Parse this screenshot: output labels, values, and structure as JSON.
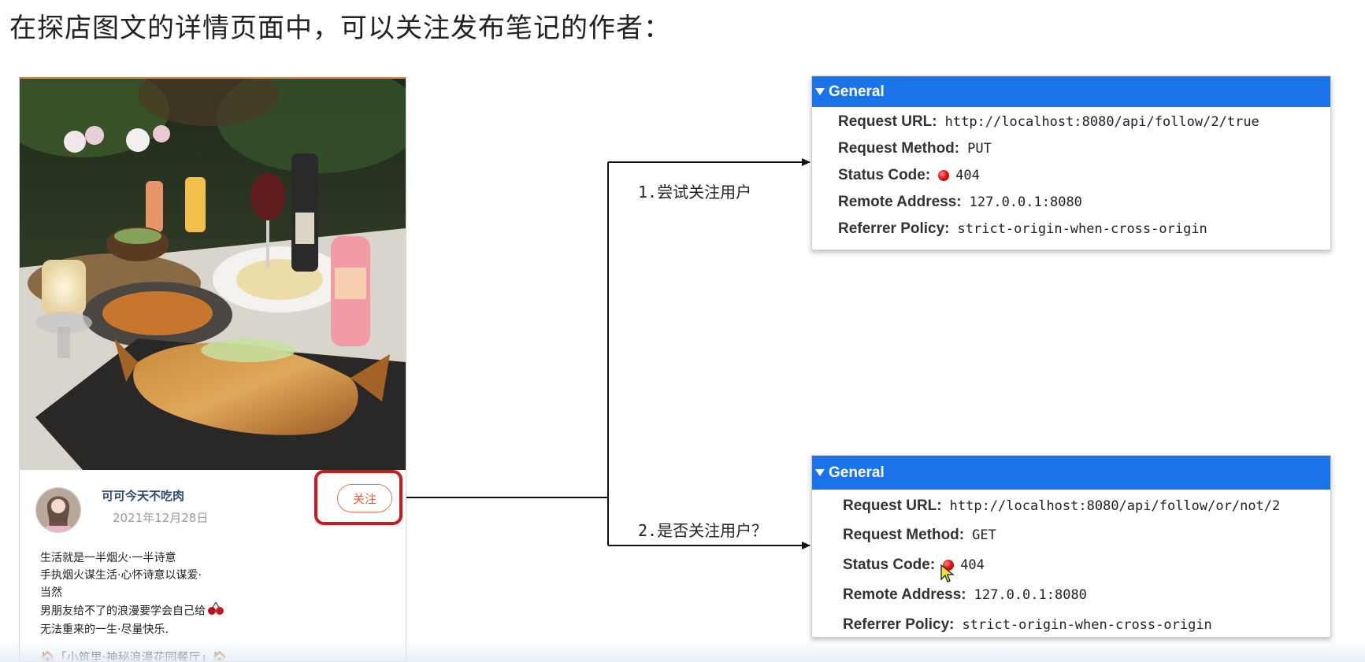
{
  "heading": "在探店图文的详情页面中，可以关注发布笔记的作者：",
  "post": {
    "author_name": "可可今天不吃肉",
    "date": "2021年12月28日",
    "follow_label": "关注",
    "lines": [
      "生活就是一半烟火·一半诗意",
      "手执烟火谋生活·心怀诗意以谋爱·",
      "当然",
      "男朋友给不了的浪漫要学会自己给",
      "无法重来的一生·尽量快乐."
    ],
    "footer": "🏠「小筑里·神秘浪漫花园餐厅」🏠",
    "icons": [
      "cherry-icon"
    ]
  },
  "steps": [
    {
      "label": "1.尝试关注用户"
    },
    {
      "label": "2.是否关注用户？"
    }
  ],
  "panels": [
    {
      "header": "General",
      "rows": [
        {
          "label": "Request URL:",
          "value": "http://localhost:8080/api/follow/2/true"
        },
        {
          "label": "Request Method:",
          "value": "PUT"
        },
        {
          "label": "Status Code:",
          "value": "404",
          "status": "error"
        },
        {
          "label": "Remote Address:",
          "value": "127.0.0.1:8080"
        },
        {
          "label": "Referrer Policy:",
          "value": "strict-origin-when-cross-origin"
        }
      ]
    },
    {
      "header": "General",
      "rows": [
        {
          "label": "Request URL:",
          "value": "http://localhost:8080/api/follow/or/not/2"
        },
        {
          "label": "Request Method:",
          "value": "GET"
        },
        {
          "label": "Status Code:",
          "value": "404",
          "status": "error"
        },
        {
          "label": "Remote Address:",
          "value": "127.0.0.1:8080"
        },
        {
          "label": "Referrer Policy:",
          "value": "strict-origin-when-cross-origin"
        }
      ]
    }
  ],
  "colors": {
    "devtools_header": "#1a73e8",
    "highlight_border": "#d0171b",
    "follow_text": "#e0623a",
    "status_error": "#e01515"
  }
}
